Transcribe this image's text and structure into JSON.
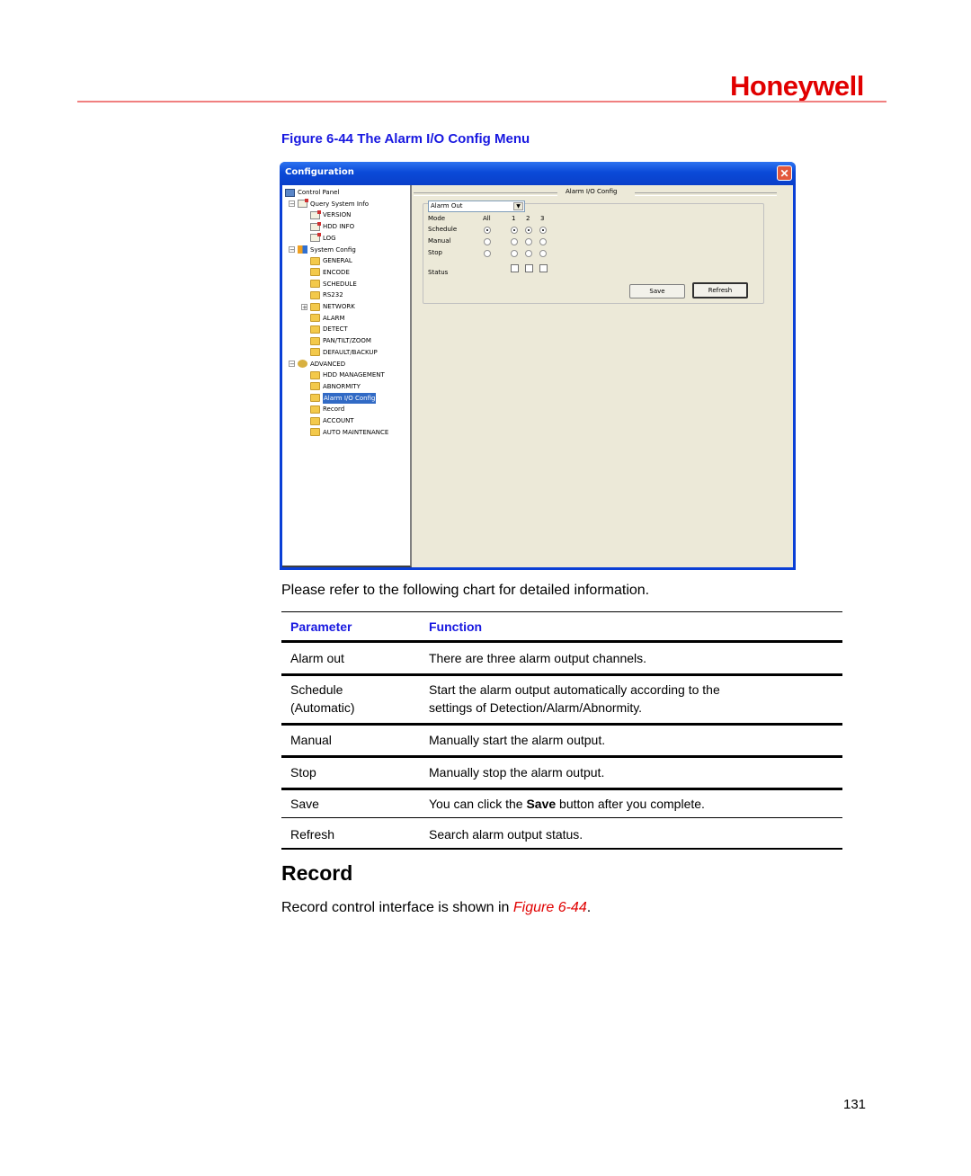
{
  "brand": "Honeywell",
  "figure_caption": "Figure 6-44 The Alarm I/O Config Menu",
  "dialog": {
    "title": "Configuration",
    "close_icon": "close-icon",
    "tree": [
      {
        "label": "Control Panel",
        "icon": "computer-icon",
        "level": 0
      },
      {
        "label": "Query System Info",
        "icon": "notepad-icon",
        "level": 1,
        "expander": "−"
      },
      {
        "label": "VERSION",
        "icon": "notepad-icon",
        "level": 2
      },
      {
        "label": "HDD INFO",
        "icon": "notepad-icon",
        "level": 2
      },
      {
        "label": "LOG",
        "icon": "notepad-icon",
        "level": 2
      },
      {
        "label": "System Config",
        "icon": "tools-icon",
        "level": 1,
        "expander": "−"
      },
      {
        "label": "GENERAL",
        "icon": "folder-icon",
        "level": 2
      },
      {
        "label": "ENCODE",
        "icon": "folder-icon",
        "level": 2
      },
      {
        "label": "SCHEDULE",
        "icon": "folder-icon",
        "level": 2
      },
      {
        "label": "RS232",
        "icon": "folder-icon",
        "level": 2
      },
      {
        "label": "NETWORK",
        "icon": "folder-icon",
        "level": 2,
        "expander": "+"
      },
      {
        "label": "ALARM",
        "icon": "folder-icon",
        "level": 2
      },
      {
        "label": "DETECT",
        "icon": "folder-icon",
        "level": 2
      },
      {
        "label": "PAN/TILT/ZOOM",
        "icon": "folder-icon",
        "level": 2
      },
      {
        "label": "DEFAULT/BACKUP",
        "icon": "folder-icon",
        "level": 2
      },
      {
        "label": "ADVANCED",
        "icon": "gears-icon",
        "level": 1,
        "expander": "−"
      },
      {
        "label": "HDD MANAGEMENT",
        "icon": "folder-icon",
        "level": 2
      },
      {
        "label": "ABNORMITY",
        "icon": "folder-icon",
        "level": 2
      },
      {
        "label": "Alarm I/O Config",
        "icon": "open-folder-icon",
        "level": 2,
        "selected": true
      },
      {
        "label": "Record",
        "icon": "folder-icon",
        "level": 2
      },
      {
        "label": "ACCOUNT",
        "icon": "folder-icon",
        "level": 2
      },
      {
        "label": "AUTO MAINTENANCE",
        "icon": "folder-icon",
        "level": 2
      }
    ],
    "panel": {
      "title": "Alarm I/O Config",
      "dropdown_value": "Alarm Out",
      "header_mode": "Mode",
      "columns": [
        "All",
        "1",
        "2",
        "3"
      ],
      "rows": [
        {
          "label": "Schedule",
          "selected": [
            true,
            true,
            true,
            true
          ]
        },
        {
          "label": "Manual",
          "selected": [
            false,
            false,
            false,
            false
          ]
        },
        {
          "label": "Stop",
          "selected": [
            false,
            false,
            false,
            false
          ]
        }
      ],
      "status_label": "Status",
      "status_checked": [
        false,
        false,
        false
      ],
      "save_label": "Save",
      "refresh_label": "Refresh"
    }
  },
  "intro": "Please refer to the following chart for detailed information.",
  "table": {
    "headers": [
      "Parameter",
      "Function"
    ],
    "rows": [
      {
        "param": [
          "Alarm out"
        ],
        "func": [
          "There are three alarm output channels."
        ]
      },
      {
        "param": [
          "Schedule",
          "(Automatic)"
        ],
        "func": [
          "Start the alarm output automatically according to the",
          "settings of Detection/Alarm/Abnormity."
        ]
      },
      {
        "param": [
          "Manual"
        ],
        "func": [
          "Manually start the alarm output."
        ]
      },
      {
        "param": [
          "Stop"
        ],
        "func": [
          "Manually stop the alarm output."
        ]
      },
      {
        "param": [
          "Save"
        ],
        "func_pre": "You can click the ",
        "func_bold": "Save",
        "func_post": " button after you complete."
      },
      {
        "param": [
          "Refresh"
        ],
        "func": [
          "Search alarm output status."
        ]
      }
    ]
  },
  "section_heading": "Record",
  "paragraph": {
    "text": "Record control interface is shown in ",
    "link": "Figure 6-44",
    "suffix": "."
  },
  "page_number": "131"
}
